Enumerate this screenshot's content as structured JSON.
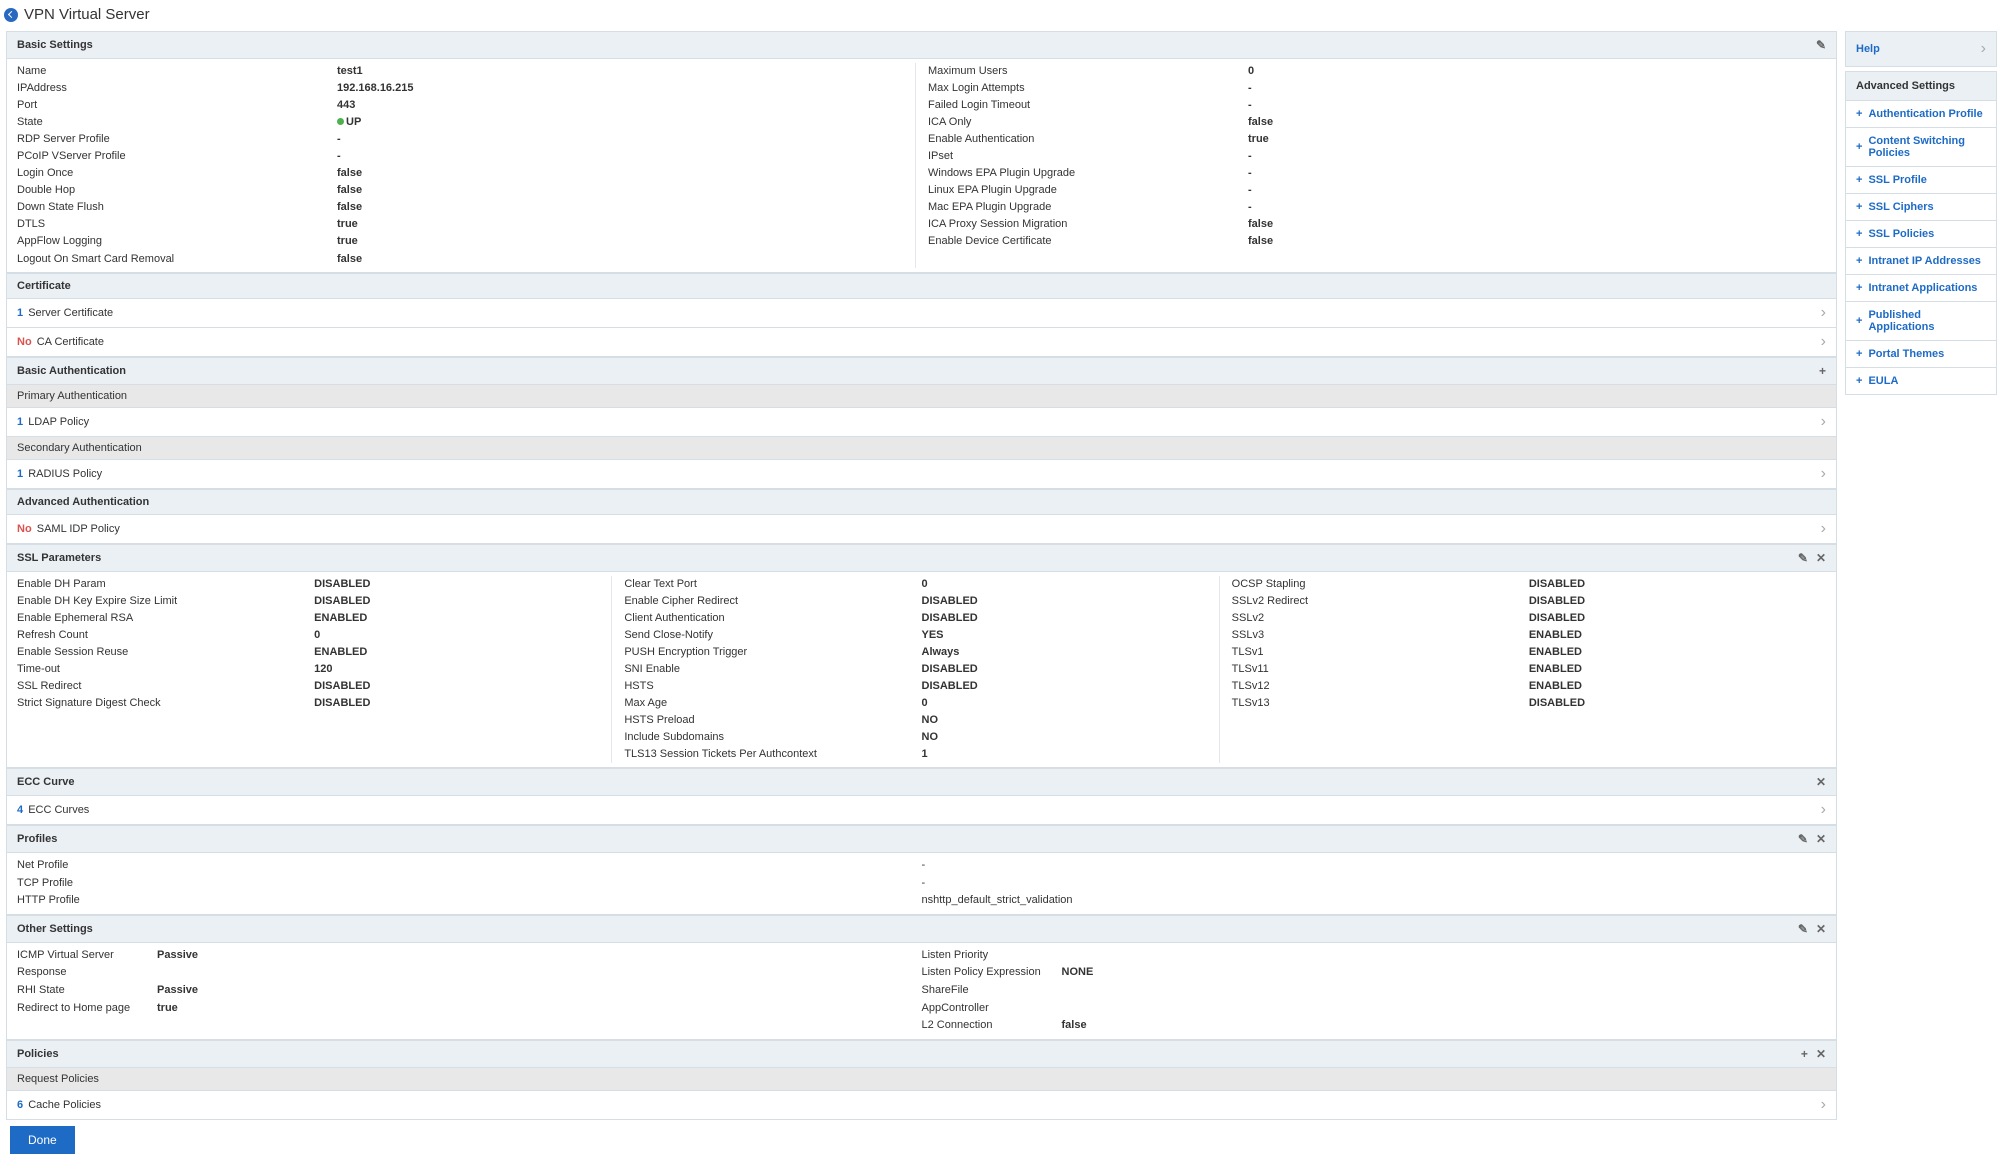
{
  "title": "VPN Virtual Server",
  "sections": {
    "basic": "Basic Settings",
    "cert": "Certificate",
    "basicAuth": "Basic Authentication",
    "priAuth": "Primary Authentication",
    "secAuth": "Secondary Authentication",
    "advAuth": "Advanced Authentication",
    "ssl": "SSL Parameters",
    "ecc": "ECC Curve",
    "profiles": "Profiles",
    "other": "Other Settings",
    "policies": "Policies",
    "reqPol": "Request Policies"
  },
  "basic": {
    "left": [
      {
        "l": "Name",
        "v": "test1"
      },
      {
        "l": "IPAddress",
        "v": "192.168.16.215"
      },
      {
        "l": "Port",
        "v": "443"
      },
      {
        "l": "State",
        "v": "UP",
        "up": true
      },
      {
        "l": "RDP Server Profile",
        "v": "-"
      },
      {
        "l": "PCoIP VServer Profile",
        "v": "-"
      },
      {
        "l": "Login Once",
        "v": "false"
      },
      {
        "l": "Double Hop",
        "v": "false"
      },
      {
        "l": "Down State Flush",
        "v": "false"
      },
      {
        "l": "DTLS",
        "v": "true"
      },
      {
        "l": "AppFlow Logging",
        "v": "true"
      },
      {
        "l": "Logout On Smart Card Removal",
        "v": "false"
      }
    ],
    "right": [
      {
        "l": "Maximum Users",
        "v": "0"
      },
      {
        "l": "Max Login Attempts",
        "v": "-"
      },
      {
        "l": "Failed Login Timeout",
        "v": "-"
      },
      {
        "l": "ICA Only",
        "v": "false"
      },
      {
        "l": "Enable Authentication",
        "v": "true"
      },
      {
        "l": "IPset",
        "v": "-"
      },
      {
        "l": "Windows EPA Plugin Upgrade",
        "v": "-"
      },
      {
        "l": "Linux EPA Plugin Upgrade",
        "v": "-"
      },
      {
        "l": "Mac EPA Plugin Upgrade",
        "v": "-"
      },
      {
        "l": "ICA Proxy Session Migration",
        "v": "false"
      },
      {
        "l": "Enable Device Certificate",
        "v": "false"
      }
    ]
  },
  "cert": {
    "srv": {
      "c": "1",
      "t": "Server Certificate"
    },
    "ca": {
      "c": "No",
      "t": "CA Certificate",
      "no": true
    }
  },
  "auth": {
    "ldap": {
      "c": "1",
      "t": "LDAP Policy"
    },
    "radius": {
      "c": "1",
      "t": "RADIUS Policy"
    },
    "saml": {
      "c": "No",
      "t": "SAML IDP Policy",
      "no": true
    }
  },
  "ssl": {
    "c1": [
      {
        "l": "Enable DH Param",
        "v": "DISABLED"
      },
      {
        "l": "Enable DH Key Expire Size Limit",
        "v": "DISABLED"
      },
      {
        "l": "Enable Ephemeral RSA",
        "v": "ENABLED"
      },
      {
        "l": "Refresh Count",
        "v": "0"
      },
      {
        "l": "Enable Session Reuse",
        "v": "ENABLED"
      },
      {
        "l": "Time-out",
        "v": "120"
      },
      {
        "l": "SSL Redirect",
        "v": "DISABLED"
      },
      {
        "l": "Strict Signature Digest Check",
        "v": "DISABLED"
      }
    ],
    "c2": [
      {
        "l": "Clear Text Port",
        "v": "0"
      },
      {
        "l": "Enable Cipher Redirect",
        "v": "DISABLED"
      },
      {
        "l": "Client Authentication",
        "v": "DISABLED"
      },
      {
        "l": "Send Close-Notify",
        "v": "YES"
      },
      {
        "l": "PUSH Encryption Trigger",
        "v": "Always"
      },
      {
        "l": "SNI Enable",
        "v": "DISABLED"
      },
      {
        "l": "HSTS",
        "v": "DISABLED"
      },
      {
        "l": "Max Age",
        "v": "0"
      },
      {
        "l": "HSTS Preload",
        "v": "NO"
      },
      {
        "l": "Include Subdomains",
        "v": "NO"
      },
      {
        "l": "TLS13 Session Tickets Per Authcontext",
        "v": "1"
      }
    ],
    "c3": [
      {
        "l": "OCSP Stapling",
        "v": "DISABLED"
      },
      {
        "l": "SSLv2 Redirect",
        "v": "DISABLED"
      },
      {
        "l": "SSLv2",
        "v": "DISABLED"
      },
      {
        "l": "SSLv3",
        "v": "ENABLED"
      },
      {
        "l": "TLSv1",
        "v": "ENABLED"
      },
      {
        "l": "TLSv11",
        "v": "ENABLED"
      },
      {
        "l": "TLSv12",
        "v": "ENABLED"
      },
      {
        "l": "TLSv13",
        "v": "DISABLED"
      }
    ]
  },
  "ecc": {
    "c": "4",
    "t": "ECC Curves"
  },
  "profiles": [
    {
      "l": "Net Profile",
      "v": "-"
    },
    {
      "l": "TCP Profile",
      "v": "-"
    },
    {
      "l": "HTTP Profile",
      "v": "nshttp_default_strict_validation"
    }
  ],
  "other": {
    "left": [
      {
        "l": "ICMP Virtual Server Response",
        "v": "Passive"
      },
      {
        "l": "RHI State",
        "v": "Passive"
      },
      {
        "l": "Redirect to Home page",
        "v": "true"
      }
    ],
    "right": [
      {
        "l": "Listen Priority",
        "v": ""
      },
      {
        "l": "Listen Policy Expression",
        "v": "NONE"
      },
      {
        "l": "ShareFile",
        "v": ""
      },
      {
        "l": "AppController",
        "v": ""
      },
      {
        "l": "L2 Connection",
        "v": "false"
      }
    ]
  },
  "policies": {
    "cache": {
      "c": "6",
      "t": "Cache Policies"
    }
  },
  "help": "Help",
  "advSettings": "Advanced Settings",
  "adv": [
    "Authentication Profile",
    "Content Switching Policies",
    "SSL Profile",
    "SSL Ciphers",
    "SSL Policies",
    "Intranet IP Addresses",
    "Intranet Applications",
    "Published Applications",
    "Portal Themes",
    "EULA"
  ],
  "done": "Done"
}
